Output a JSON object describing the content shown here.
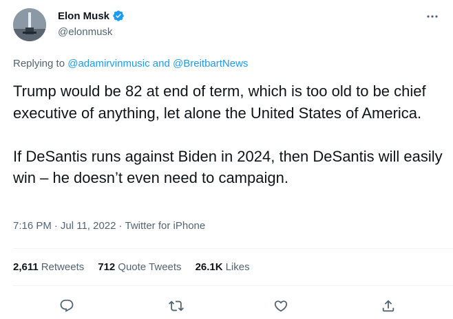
{
  "author": {
    "name": "Elon Musk",
    "handle": "@elonmusk",
    "avatar_icon": "avatar-rocket-image",
    "verified_icon": "verified-badge-icon"
  },
  "reply": {
    "prefix": "Replying to",
    "mentions": "@adamirvinmusic and @BreitbartNews"
  },
  "tweet": {
    "paragraph_1": "Trump would be 82 at end of term, which is too old to be chief executive of anything, let alone the United States of America.",
    "paragraph_2": "If DeSantis runs against Biden in 2024, then DeSantis will easily win – he doesn’t even need to campaign."
  },
  "meta": {
    "time": "7:16 PM",
    "date": "Jul 11, 2022",
    "separator": "·",
    "source": "Twitter for iPhone"
  },
  "stats": {
    "retweets_count": "2,611",
    "retweets_label": "Retweets",
    "quotes_count": "712",
    "quotes_label": "Quote Tweets",
    "likes_count": "26.1K",
    "likes_label": "Likes"
  },
  "colors": {
    "accent": "#1d9bf0",
    "text_primary": "#0f1419",
    "text_secondary": "#536471",
    "divider": "#eff3f4"
  }
}
